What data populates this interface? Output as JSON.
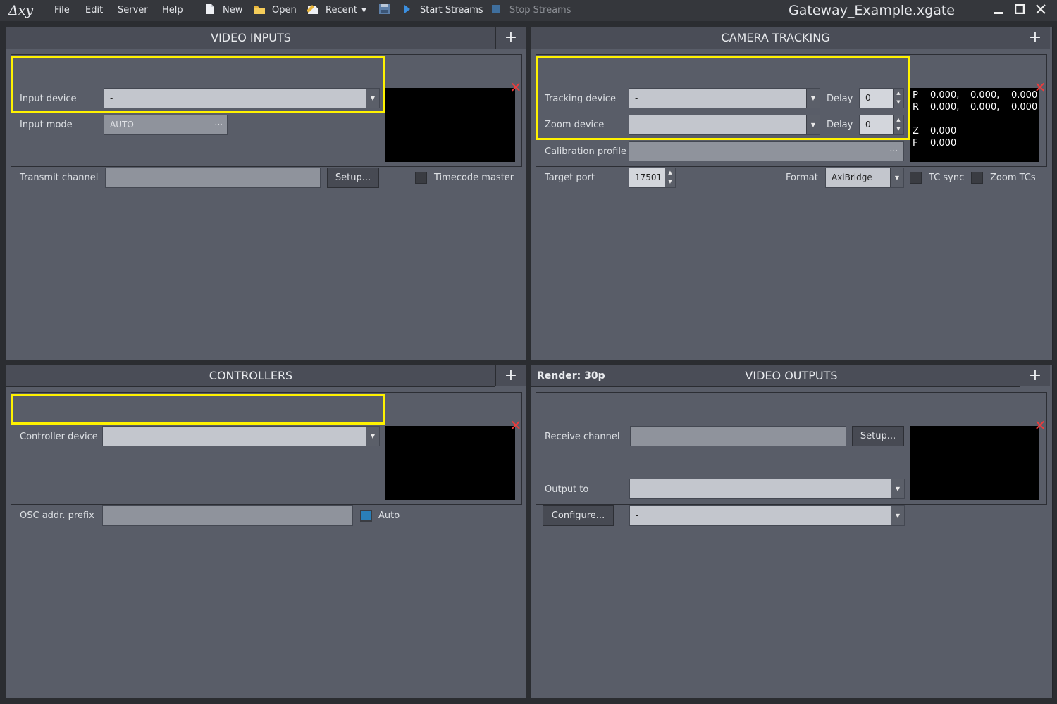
{
  "app": {
    "logo": "Δxy",
    "document_title": "Gateway_Example.xgate"
  },
  "menu": [
    "File",
    "Edit",
    "Server",
    "Help"
  ],
  "toolbar": {
    "new_label": "New",
    "open_label": "Open",
    "recent_label": "Recent",
    "start_label": "Start Streams",
    "stop_label": "Stop Streams"
  },
  "window_controls": {
    "minimize": "‗",
    "maximize": "□",
    "close": "✕"
  },
  "video_inputs": {
    "title": "VIDEO INPUTS",
    "add": "+",
    "input_device_label": "Input device",
    "input_device_value": "-",
    "input_mode_label": "Input mode",
    "input_mode_value": "AUTO",
    "input_mode_more": "···",
    "transmit_channel_label": "Transmit channel",
    "transmit_channel_value": "",
    "setup_label": "Setup...",
    "timecode_master_label": "Timecode master"
  },
  "camera_tracking": {
    "title": "CAMERA TRACKING",
    "add": "+",
    "tracking_device_label": "Tracking device",
    "tracking_device_value": "-",
    "zoom_device_label": "Zoom device",
    "zoom_device_value": "-",
    "delay_label": "Delay",
    "tracking_delay": "0",
    "zoom_delay": "0",
    "calibration_profile_label": "Calibration profile",
    "calibration_more": "···",
    "target_port_label": "Target port",
    "target_port_value": "17501",
    "format_label": "Format",
    "format_value": "AxiBridge",
    "tc_sync_label": "TC sync",
    "zoom_tcs_label": "Zoom TCs",
    "readout": {
      "p_label": "P",
      "p_values": [
        "0.000,",
        "0.000,",
        "0.000"
      ],
      "r_label": "R",
      "r_values": [
        "0.000,",
        "0.000,",
        "0.000"
      ],
      "z_label": "Z",
      "z_value": "0.000",
      "f_label": "F",
      "f_value": "0.000"
    }
  },
  "controllers": {
    "title": "CONTROLLERS",
    "add": "+",
    "controller_device_label": "Controller device",
    "controller_device_value": "-",
    "osc_prefix_label": "OSC addr. prefix",
    "osc_prefix_value": "",
    "auto_label": "Auto"
  },
  "video_outputs": {
    "render_label": "Render: 30p",
    "title": "VIDEO OUTPUTS",
    "add": "+",
    "receive_channel_label": "Receive channel",
    "receive_channel_value": "",
    "setup_label": "Setup...",
    "output_to_label": "Output to",
    "output_to_value": "-",
    "configure_label": "Configure...",
    "configure_value": "-"
  },
  "colors": {
    "highlight": "#fff200",
    "panel": "#595d68",
    "close_x": "#ee3b3b",
    "checked": "#2a7fb8"
  }
}
